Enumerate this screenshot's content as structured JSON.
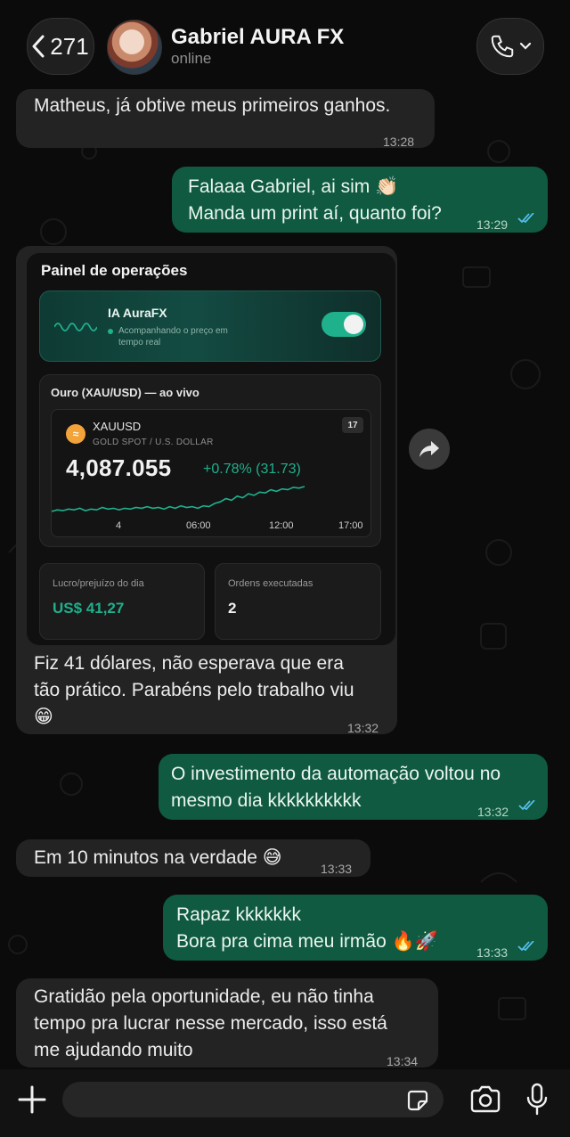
{
  "header": {
    "back_count": "271",
    "contact_name": "Gabriel AURA FX",
    "status": "online"
  },
  "messages": [
    {
      "text": "Matheus, já obtive meus primeiros ganhos.",
      "time": "13:28"
    },
    {
      "line1": "Falaaa Gabriel, ai sim 👏🏻",
      "line2": "Manda um print aí, quanto foi?",
      "time": "13:29"
    },
    {
      "line1": "Fiz 41 dólares, não esperava que era",
      "line2": "tão prático. Parabéns pelo trabalho viu",
      "line3": "😁",
      "time": "13:32"
    },
    {
      "line1": "O investimento da automação voltou no",
      "line2": "mesmo dia kkkkkkkkkk",
      "time": "13:32"
    },
    {
      "text": "Em 10 minutos na verdade 😅",
      "time": "13:33"
    },
    {
      "line1": "Rapaz kkkkkkk",
      "line2": "Bora pra cima meu irmão 🔥🚀",
      "time": "13:33"
    },
    {
      "line1": "Gratidão pela oportunidade, eu não tinha",
      "line2": "tempo pra lucrar nesse mercado, isso está",
      "line3": "me ajudando muito",
      "time": "13:34"
    }
  ],
  "panel": {
    "title": "Painel de operações",
    "aura_title": "IA AuraFX",
    "aura_subtitle": "Acompanhando o preço em tempo real",
    "aura_enabled": true,
    "gold_title": "Ouro (XAU/USD) — ao vivo",
    "symbol": "XAUUSD",
    "symbol_sub": "GOLD SPOT / U.S. DOLLAR",
    "tv_badge": "17",
    "price": "4,087.055",
    "change": "+0.78% (31.73)",
    "profit_label": "Lucro/prejuízo do dia",
    "profit_value": "US$ 41,27",
    "orders_label": "Ordens executadas",
    "orders_value": "2"
  },
  "chart_data": {
    "type": "line",
    "x_ticks": [
      "4",
      "06:00",
      "12:00",
      "17:00"
    ],
    "series": [
      {
        "values": [
          4056,
          4058,
          4057,
          4059,
          4058,
          4060,
          4057,
          4059,
          4058,
          4061,
          4059,
          4060,
          4058,
          4060,
          4059,
          4061,
          4060,
          4062,
          4060,
          4061,
          4059,
          4062,
          4060,
          4063,
          4061,
          4062,
          4060,
          4063,
          4062,
          4066,
          4068,
          4072,
          4070,
          4075,
          4073,
          4078,
          4076,
          4080,
          4079,
          4083,
          4081,
          4084,
          4083,
          4086,
          4085,
          4087
        ]
      }
    ]
  },
  "input": {
    "placeholder": ""
  },
  "colors": {
    "accent": "#1fb08c",
    "outgoing": "#0f5a40",
    "incoming": "#232323",
    "read_ticks": "#53bdeb"
  }
}
